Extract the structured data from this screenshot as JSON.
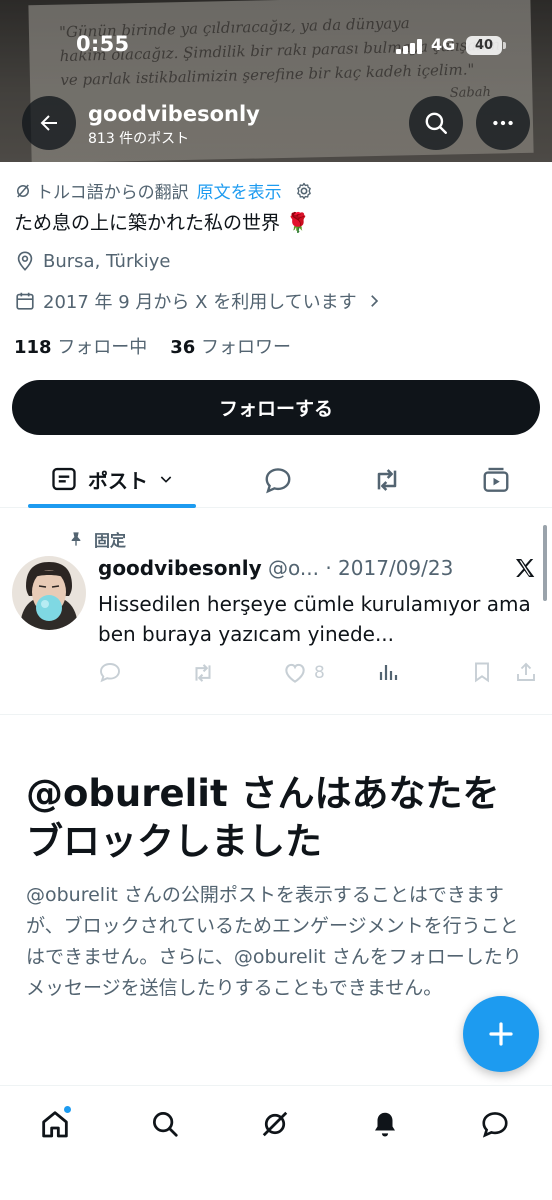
{
  "status": {
    "time": "0:55",
    "network": "4G",
    "battery": "40"
  },
  "banner": {
    "quote_lines": [
      "\"Günün birinde ya çıldıracağız, ya da dünyaya",
      "hakim olacağız. Şimdilik bir rakı parası bulmaya çalışalım",
      "ve parlak istikbalimizin şerefine bir kaç kadeh içelim.\""
    ],
    "signature": "Sabah"
  },
  "header": {
    "username": "goodvibesonly",
    "post_count": "813 件のポスト"
  },
  "profile": {
    "translated_from": "トルコ語からの翻訳",
    "show_original": "原文を表示",
    "bio": "ため息の上に築かれた私の世界 🌹",
    "location": "Bursa, Türkiye",
    "joined": "2017 年 9 月から X を利用しています",
    "following_count": "118",
    "following_label": "フォロー中",
    "followers_count": "36",
    "followers_label": "フォロワー",
    "follow_button": "フォローする"
  },
  "tabs": {
    "posts_label": "ポスト"
  },
  "pinned_post": {
    "pinned_label": "固定",
    "display_name": "goodvibesonly",
    "handle_date": " @o... · 2017/09/23",
    "text": "Hissedilen herşeye cümle kurulamıyor ama ben buraya yazıcam yinede...",
    "like_count": "8"
  },
  "blocked": {
    "title": "@oburelit さんはあなたをブロックしました",
    "body": "@oburelit さんの公開ポストを表示することはできますが、ブロックされているためエンゲージメントを行うことはできません。さらに、@oburelit さんをフォローしたりメッセージを送信したりすることもできません。"
  },
  "icons": {
    "back": "arrow-left-icon",
    "search": "search-icon",
    "more": "more-icon",
    "translate": "translate-icon",
    "settings": "gear-icon",
    "location": "location-pin-icon",
    "calendar": "calendar-icon",
    "x_logo": "x-logo-icon",
    "compose": "plus-icon"
  },
  "colors": {
    "accent": "#1d9bf0",
    "text": "#0f1419",
    "secondary": "#536471",
    "button": "#0f1419"
  }
}
